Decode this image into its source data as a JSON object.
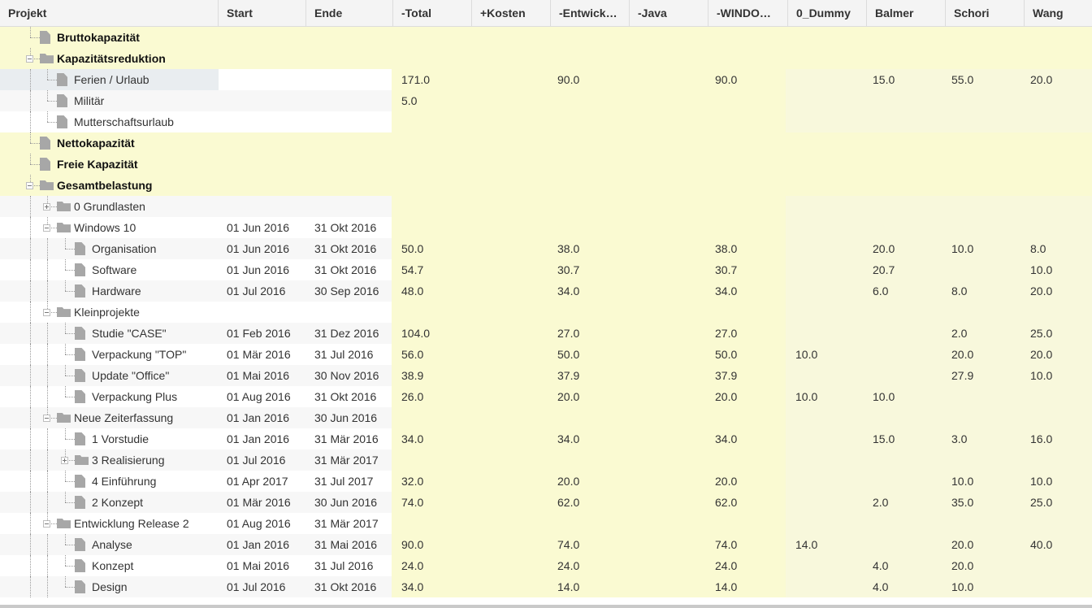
{
  "columns": [
    "Projekt",
    "Start",
    "Ende",
    "-Total",
    "+Kosten",
    "-Entwick…",
    "-Java",
    "-WINDO…",
    "0_Dummy",
    "Balmer",
    "Schori",
    "Wang"
  ],
  "rows": [
    {
      "name": "Bruttokapazität",
      "type": "file",
      "level": 1,
      "kind": "sum",
      "start": "",
      "end": "",
      "total": "",
      "kosten": "",
      "entw": "",
      "java": "",
      "wind": "",
      "dummy": "",
      "balmer": "",
      "schori": "",
      "wang": ""
    },
    {
      "name": "Kapazitätsreduktion",
      "type": "folder",
      "level": 1,
      "kind": "sum",
      "expanded": true,
      "start": "",
      "end": "",
      "total": "",
      "kosten": "",
      "entw": "",
      "java": "",
      "wind": "",
      "dummy": "",
      "balmer": "",
      "schori": "",
      "wang": ""
    },
    {
      "name": "Ferien / Urlaub",
      "type": "file",
      "level": 2,
      "kind": "plain",
      "selected": true,
      "start": "",
      "end": "",
      "total": "171.0",
      "kosten": "",
      "entw": "90.0",
      "java": "",
      "wind": "90.0",
      "dummy": "",
      "balmer": "15.0",
      "schori": "55.0",
      "wang": "20.0"
    },
    {
      "name": "Militär",
      "type": "file",
      "level": 2,
      "kind": "plain",
      "start": "",
      "end": "",
      "total": "5.0",
      "kosten": "",
      "entw": "",
      "java": "",
      "wind": "",
      "dummy": "",
      "balmer": "",
      "schori": "",
      "wang": ""
    },
    {
      "name": "Mutterschaftsurlaub",
      "type": "file",
      "level": 2,
      "kind": "plain",
      "start": "",
      "end": "",
      "total": "",
      "kosten": "",
      "entw": "",
      "java": "",
      "wind": "",
      "dummy": "",
      "balmer": "",
      "schori": "",
      "wang": ""
    },
    {
      "name": "Nettokapazität",
      "type": "file",
      "level": 1,
      "kind": "sum",
      "start": "",
      "end": "",
      "total": "",
      "kosten": "",
      "entw": "",
      "java": "",
      "wind": "",
      "dummy": "",
      "balmer": "",
      "schori": "",
      "wang": ""
    },
    {
      "name": "Freie Kapazität",
      "type": "file",
      "level": 1,
      "kind": "sum",
      "start": "",
      "end": "",
      "total": "",
      "kosten": "",
      "entw": "",
      "java": "",
      "wind": "",
      "dummy": "",
      "balmer": "",
      "schori": "",
      "wang": ""
    },
    {
      "name": "Gesamtbelastung",
      "type": "folder",
      "level": 1,
      "kind": "sum",
      "expanded": true,
      "start": "",
      "end": "",
      "total": "",
      "kosten": "",
      "entw": "",
      "java": "",
      "wind": "",
      "dummy": "",
      "balmer": "",
      "schori": "",
      "wang": ""
    },
    {
      "name": "0 Grundlasten",
      "type": "folder",
      "level": 2,
      "kind": "plain",
      "expanded": false,
      "start": "",
      "end": "",
      "total": "",
      "kosten": "",
      "entw": "",
      "java": "",
      "wind": "",
      "dummy": "",
      "balmer": "",
      "schori": "",
      "wang": ""
    },
    {
      "name": "Windows 10",
      "type": "folder",
      "level": 2,
      "kind": "plain",
      "expanded": true,
      "start": "01 Jun 2016",
      "end": "31 Okt 2016",
      "total": "",
      "kosten": "",
      "entw": "",
      "java": "",
      "wind": "",
      "dummy": "",
      "balmer": "",
      "schori": "",
      "wang": ""
    },
    {
      "name": "Organisation",
      "type": "file",
      "level": 3,
      "kind": "plain",
      "start": "01 Jun 2016",
      "end": "31 Okt 2016",
      "total": "50.0",
      "kosten": "",
      "entw": "38.0",
      "java": "",
      "wind": "38.0",
      "dummy": "",
      "balmer": "20.0",
      "schori": "10.0",
      "wang": "8.0"
    },
    {
      "name": "Software",
      "type": "file",
      "level": 3,
      "kind": "plain",
      "start": "01 Jun 2016",
      "end": "31 Okt 2016",
      "total": "54.7",
      "kosten": "",
      "entw": "30.7",
      "java": "",
      "wind": "30.7",
      "dummy": "",
      "balmer": "20.7",
      "schori": "",
      "wang": "10.0"
    },
    {
      "name": "Hardware",
      "type": "file",
      "level": 3,
      "kind": "plain",
      "start": "01 Jul 2016",
      "end": "30 Sep 2016",
      "total": "48.0",
      "kosten": "",
      "entw": "34.0",
      "java": "",
      "wind": "34.0",
      "dummy": "",
      "balmer": "6.0",
      "schori": "8.0",
      "wang": "20.0"
    },
    {
      "name": "Kleinprojekte",
      "type": "folder",
      "level": 2,
      "kind": "plain",
      "expanded": true,
      "start": "",
      "end": "",
      "total": "",
      "kosten": "",
      "entw": "",
      "java": "",
      "wind": "",
      "dummy": "",
      "balmer": "",
      "schori": "",
      "wang": ""
    },
    {
      "name": "Studie \"CASE\"",
      "type": "file",
      "level": 3,
      "kind": "plain",
      "start": "01 Feb 2016",
      "end": "31 Dez 2016",
      "total": "104.0",
      "kosten": "",
      "entw": "27.0",
      "java": "",
      "wind": "27.0",
      "dummy": "",
      "balmer": "",
      "schori": "2.0",
      "wang": "25.0"
    },
    {
      "name": "Verpackung \"TOP\"",
      "type": "file",
      "level": 3,
      "kind": "plain",
      "start": "01 Mär 2016",
      "end": "31 Jul 2016",
      "total": "56.0",
      "kosten": "",
      "entw": "50.0",
      "java": "",
      "wind": "50.0",
      "dummy": "10.0",
      "balmer": "",
      "schori": "20.0",
      "wang": "20.0"
    },
    {
      "name": "Update \"Office\"",
      "type": "file",
      "level": 3,
      "kind": "plain",
      "start": "01 Mai 2016",
      "end": "30 Nov 2016",
      "total": "38.9",
      "kosten": "",
      "entw": "37.9",
      "java": "",
      "wind": "37.9",
      "dummy": "",
      "balmer": "",
      "schori": "27.9",
      "wang": "10.0"
    },
    {
      "name": "Verpackung Plus",
      "type": "file",
      "level": 3,
      "kind": "plain",
      "start": "01 Aug 2016",
      "end": "31 Okt 2016",
      "total": "26.0",
      "kosten": "",
      "entw": "20.0",
      "java": "",
      "wind": "20.0",
      "dummy": "10.0",
      "balmer": "10.0",
      "schori": "",
      "wang": ""
    },
    {
      "name": "Neue Zeiterfassung",
      "type": "folder",
      "level": 2,
      "kind": "plain",
      "expanded": true,
      "start": "01 Jan 2016",
      "end": "30 Jun 2016",
      "total": "",
      "kosten": "",
      "entw": "",
      "java": "",
      "wind": "",
      "dummy": "",
      "balmer": "",
      "schori": "",
      "wang": ""
    },
    {
      "name": "1 Vorstudie",
      "type": "file",
      "level": 3,
      "kind": "plain",
      "start": "01 Jan 2016",
      "end": "31 Mär 2016",
      "total": "34.0",
      "kosten": "",
      "entw": "34.0",
      "java": "",
      "wind": "34.0",
      "dummy": "",
      "balmer": "15.0",
      "schori": "3.0",
      "wang": "16.0"
    },
    {
      "name": "3 Realisierung",
      "type": "folder",
      "level": 3,
      "kind": "plain",
      "expanded": false,
      "start": "01 Jul 2016",
      "end": "31 Mär 2017",
      "total": "",
      "kosten": "",
      "entw": "",
      "java": "",
      "wind": "",
      "dummy": "",
      "balmer": "",
      "schori": "",
      "wang": ""
    },
    {
      "name": "4 Einführung",
      "type": "file",
      "level": 3,
      "kind": "plain",
      "start": "01 Apr 2017",
      "end": "31 Jul 2017",
      "total": "32.0",
      "kosten": "",
      "entw": "20.0",
      "java": "",
      "wind": "20.0",
      "dummy": "",
      "balmer": "",
      "schori": "10.0",
      "wang": "10.0"
    },
    {
      "name": "2 Konzept",
      "type": "file",
      "level": 3,
      "kind": "plain",
      "start": "01 Mär 2016",
      "end": "30 Jun 2016",
      "total": "74.0",
      "kosten": "",
      "entw": "62.0",
      "java": "",
      "wind": "62.0",
      "dummy": "",
      "balmer": "2.0",
      "schori": "35.0",
      "wang": "25.0"
    },
    {
      "name": "Entwicklung Release 2",
      "type": "folder",
      "level": 2,
      "kind": "plain",
      "expanded": true,
      "start": "01 Aug 2016",
      "end": "31 Mär 2017",
      "total": "",
      "kosten": "",
      "entw": "",
      "java": "",
      "wind": "",
      "dummy": "",
      "balmer": "",
      "schori": "",
      "wang": ""
    },
    {
      "name": "Analyse",
      "type": "file",
      "level": 3,
      "kind": "plain",
      "start": "01 Jan 2016",
      "end": "31 Mai 2016",
      "total": "90.0",
      "kosten": "",
      "entw": "74.0",
      "java": "",
      "wind": "74.0",
      "dummy": "14.0",
      "balmer": "",
      "schori": "20.0",
      "wang": "40.0"
    },
    {
      "name": "Konzept",
      "type": "file",
      "level": 3,
      "kind": "plain",
      "start": "01 Mai 2016",
      "end": "31 Jul 2016",
      "total": "24.0",
      "kosten": "",
      "entw": "24.0",
      "java": "",
      "wind": "24.0",
      "dummy": "",
      "balmer": "4.0",
      "schori": "20.0",
      "wang": ""
    },
    {
      "name": "Design",
      "type": "file",
      "level": 3,
      "kind": "plain",
      "start": "01 Jul 2016",
      "end": "31 Okt 2016",
      "total": "34.0",
      "kosten": "",
      "entw": "14.0",
      "java": "",
      "wind": "14.0",
      "dummy": "",
      "balmer": "4.0",
      "schori": "10.0",
      "wang": ""
    }
  ]
}
